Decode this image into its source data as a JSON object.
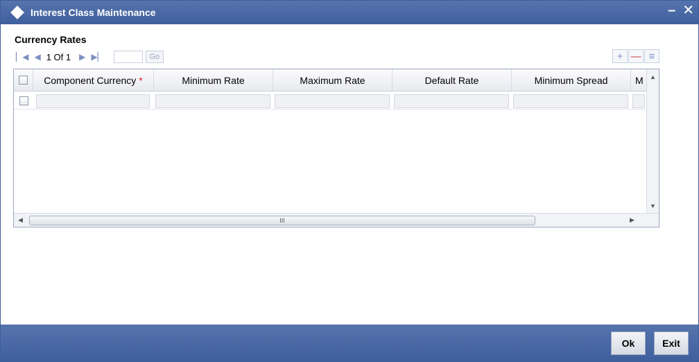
{
  "window": {
    "title": "Interest Class Maintenance",
    "minimize_glyph": "–",
    "close_glyph": "✕"
  },
  "section": {
    "title": "Currency Rates"
  },
  "pager": {
    "page_text": "1 Of 1",
    "go_label": "Go",
    "goto_value": ""
  },
  "grid": {
    "columns": [
      {
        "label": "Component Currency",
        "required": true
      },
      {
        "label": "Minimum Rate",
        "required": false
      },
      {
        "label": "Maximum Rate",
        "required": false
      },
      {
        "label": "Default Rate",
        "required": false
      },
      {
        "label": "Minimum Spread",
        "required": false
      },
      {
        "label": "M",
        "required": false
      }
    ],
    "required_marker": "*",
    "hscroll_grip": "III"
  },
  "footer": {
    "ok_label": "Ok",
    "exit_label": "Exit"
  },
  "colors": {
    "titlebar": "#4a68a5",
    "required": "#d02020"
  }
}
